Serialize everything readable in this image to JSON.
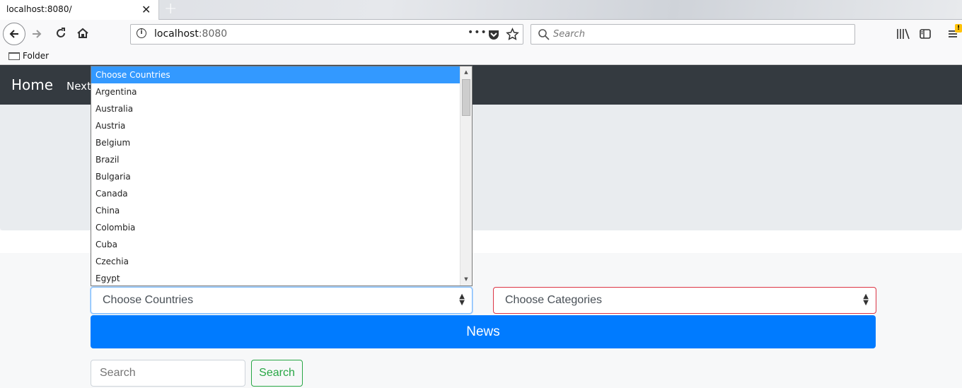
{
  "browser": {
    "tab_title": "localhost:8080/",
    "tab_close": "✕",
    "new_tab": "+",
    "url_host": "localhost",
    "url_port": ":8080",
    "search_placeholder": "Search",
    "bookmark_folder": "Folder",
    "menu_badge": "!"
  },
  "nav": {
    "brand": "Home",
    "next": "Next"
  },
  "form": {
    "country_select": "Choose Countries",
    "category_select": "Choose Categories",
    "news_button": "News",
    "search_placeholder": "Search",
    "search_button": "Search"
  },
  "dropdown": {
    "options": [
      "Choose Countries",
      "Argentina",
      "Australia",
      "Austria",
      "Belgium",
      "Brazil",
      "Bulgaria",
      "Canada",
      "China",
      "Colombia",
      "Cuba",
      "Czechia",
      "Egypt"
    ],
    "selected_index": 0
  },
  "colors": {
    "navbar": "#343a40",
    "primary": "#007bff",
    "success": "#28a745",
    "danger": "#dc3545",
    "dropdown_highlight": "#3399ff"
  }
}
